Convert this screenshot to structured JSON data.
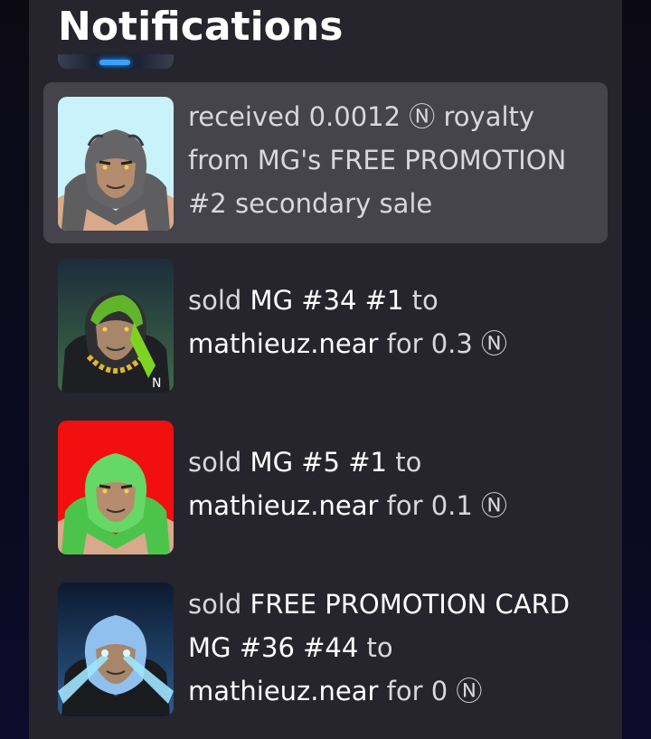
{
  "header": {
    "title": "Notifications"
  },
  "notifications": [
    {
      "highlighted": true,
      "thumb_bg": "#c9f2fb",
      "fur": "#5b5b5b",
      "verb": "received 0.0012 Ⓝ royalty from MG's FREE PROMOTION #2 secondary sale",
      "object": "",
      "suffix": ""
    },
    {
      "highlighted": false,
      "thumb_bg": "#2d4e3e",
      "fur": "#4d8a1f",
      "verb": "sold ",
      "object": "MG #34 #1",
      "mid": " to ",
      "buyer": "mathieuz.near",
      "suffix": " for 0.3 Ⓝ",
      "badge": "N"
    },
    {
      "highlighted": false,
      "thumb_bg": "#f20f0f",
      "fur": "#5ad05a",
      "verb": "sold ",
      "object": "MG #5 #1",
      "mid": " to ",
      "buyer": "mathieuz.near",
      "suffix": " for 0.1 Ⓝ"
    },
    {
      "highlighted": false,
      "thumb_bg": "#1d3a5e",
      "fur": "#7fb5e8",
      "verb": "sold ",
      "object": "FREE PROMOTION CARD MG #36 #44",
      "mid": " to ",
      "buyer": "mathieuz.near",
      "suffix": " for 0 Ⓝ"
    }
  ],
  "colors": {
    "panel": "#26242d",
    "highlight": "#45434c",
    "text": "#d8d6de",
    "strong": "#ffffff"
  }
}
